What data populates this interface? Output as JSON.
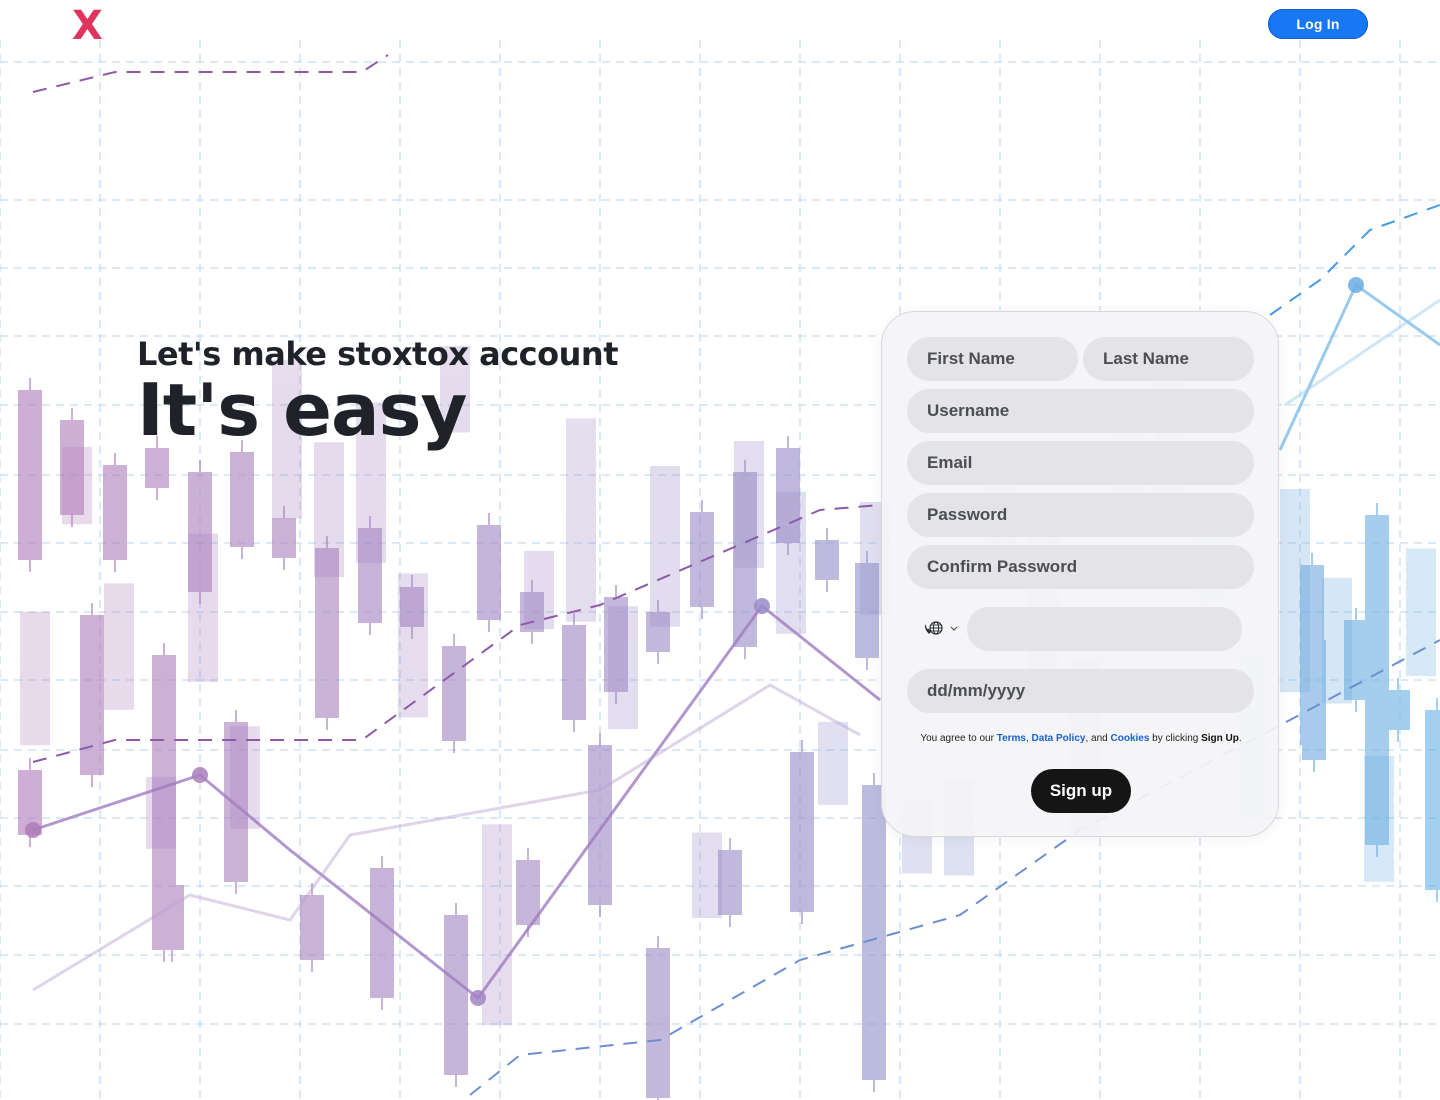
{
  "header": {
    "logo_text": "X",
    "login_label": "Log In"
  },
  "hero": {
    "subtitle": "Let's make stoxtox account",
    "title": "It's easy"
  },
  "form": {
    "first_name_placeholder": "First Name",
    "last_name_placeholder": "Last Name",
    "username_placeholder": "Username",
    "email_placeholder": "Email",
    "password_placeholder": "Password",
    "confirm_password_placeholder": "Confirm Password",
    "phone_placeholder": "",
    "phone_code_icon": "phone-globe-icon",
    "dob_placeholder": "dd/mm/yyyy",
    "agree_prefix": "You agree to our ",
    "terms_link": "Terms",
    "data_policy_link": "Data Policy",
    "cookies_link": "Cookies",
    "agree_middle": ", and ",
    "agree_suffix": " by clicking ",
    "agree_action": "Sign Up",
    "signup_label": "Sign up"
  },
  "colors": {
    "logo": "#e0335e",
    "login_button": "#1877f2",
    "signup_button": "#151515",
    "link": "#1b5fd1"
  }
}
